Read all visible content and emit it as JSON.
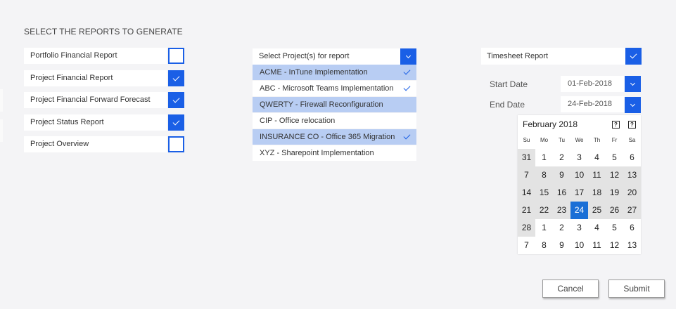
{
  "heading": "SELECT THE REPORTS TO GENERATE",
  "reports": [
    {
      "label": "Portfolio Financial Report",
      "checked": false
    },
    {
      "label": "Project Financial Report",
      "checked": true
    },
    {
      "label": "Project Financial Forward Forecast",
      "checked": true
    },
    {
      "label": "Project Status Report",
      "checked": true
    },
    {
      "label": "Project Overview",
      "checked": false
    }
  ],
  "projects": {
    "header": "Select Project(s) for report",
    "items": [
      {
        "label": "ACME - InTune Implementation",
        "highlighted": true,
        "checked": true
      },
      {
        "label": "ABC - Microsoft Teams Implementation",
        "highlighted": false,
        "checked": true
      },
      {
        "label": "QWERTY - Firewall Reconfiguration",
        "highlighted": true,
        "checked": false
      },
      {
        "label": "CIP - Office relocation",
        "highlighted": false,
        "checked": false
      },
      {
        "label": "INSURANCE CO - Office 365 Migration",
        "highlighted": true,
        "checked": true
      },
      {
        "label": "XYZ - Sharepoint Implementation",
        "highlighted": false,
        "checked": false
      }
    ]
  },
  "timesheet": {
    "label": "Timesheet Report",
    "checked": true,
    "start_label": "Start Date",
    "start_value": "01-Feb-2018",
    "end_label": "End Date",
    "end_value": "24-Feb-2018"
  },
  "calendar": {
    "title": "February 2018",
    "prev_icon": "?",
    "next_icon": "?",
    "weekdays": [
      "Su",
      "Mo",
      "Tu",
      "We",
      "Th",
      "Fr",
      "Sa"
    ],
    "weeks": [
      [
        "31",
        "1",
        "2",
        "3",
        "4",
        "5",
        "6"
      ],
      [
        "7",
        "8",
        "9",
        "10",
        "11",
        "12",
        "13"
      ],
      [
        "14",
        "15",
        "16",
        "17",
        "18",
        "19",
        "20"
      ],
      [
        "21",
        "22",
        "23",
        "24",
        "25",
        "26",
        "27"
      ],
      [
        "28",
        "1",
        "2",
        "3",
        "4",
        "5",
        "6"
      ],
      [
        "7",
        "8",
        "9",
        "10",
        "11",
        "12",
        "13"
      ]
    ],
    "selected": "24"
  },
  "buttons": {
    "cancel": "Cancel",
    "submit": "Submit"
  },
  "colors": {
    "accent": "#1a5fe6",
    "highlight": "#b8cdf3",
    "selected_day": "#1a6fd6"
  }
}
